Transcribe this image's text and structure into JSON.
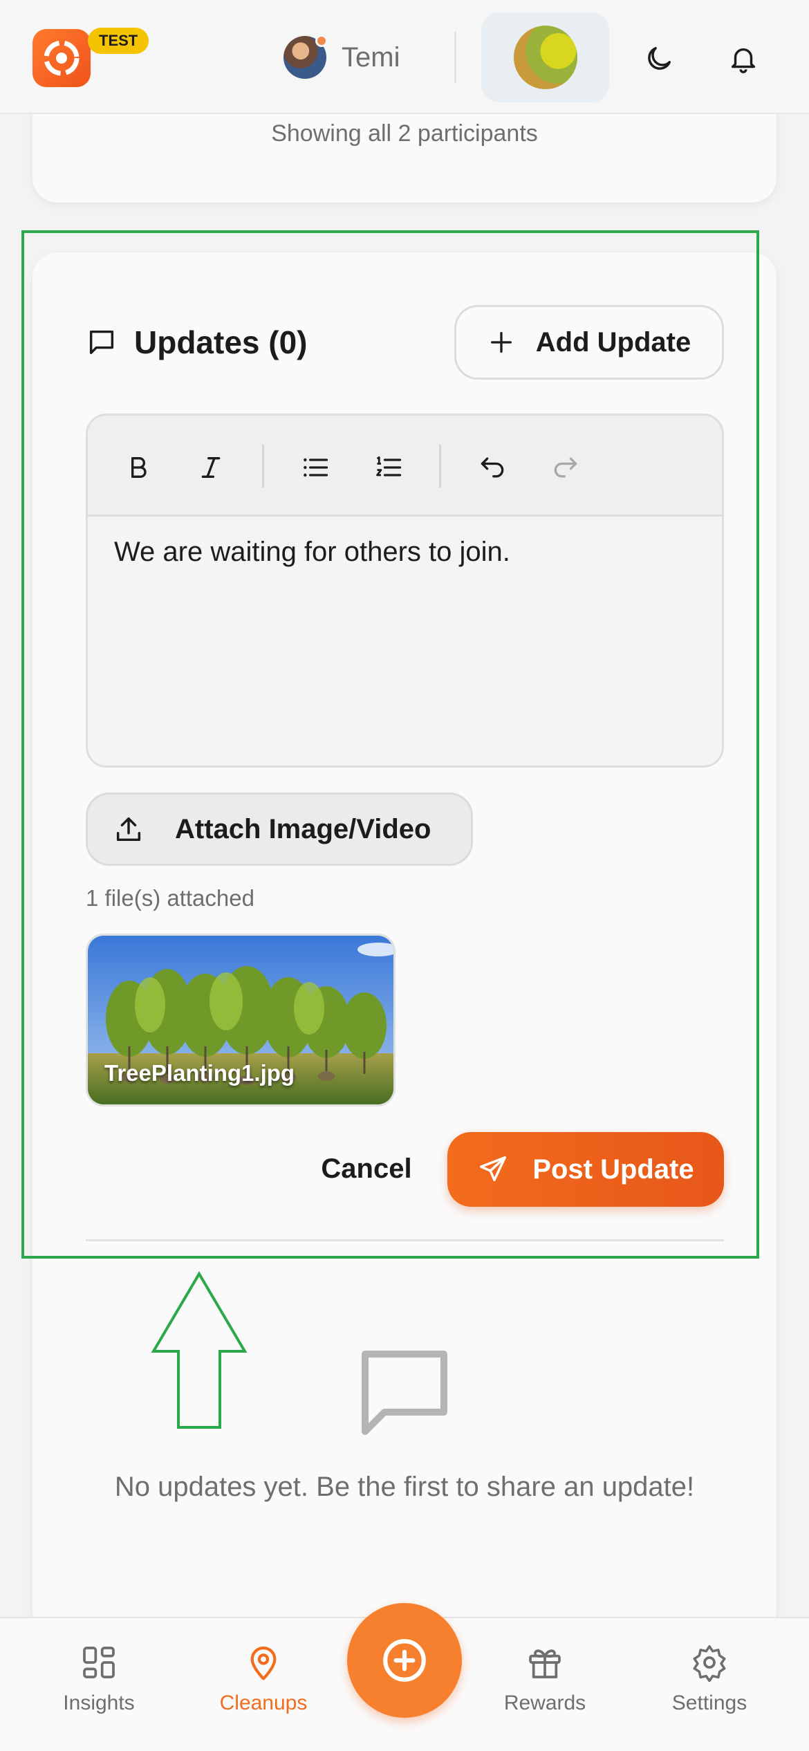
{
  "header": {
    "badge": "TEST",
    "user_name": "Temi"
  },
  "participants": {
    "summary": "Showing all 2 participants"
  },
  "updates": {
    "title": "Updates (0)",
    "add_button": "Add Update",
    "editor_text": "We are waiting for others to join.",
    "attach_button": "Attach Image/Video",
    "files_count": "1 file(s) attached",
    "attachment_name": "TreePlanting1.jpg",
    "cancel_button": "Cancel",
    "post_button": "Post Update",
    "empty_message": "No updates yet. Be the first to share an update!"
  },
  "nav": {
    "items": [
      {
        "label": "Insights",
        "icon": "grid-icon"
      },
      {
        "label": "Cleanups",
        "icon": "map-pin-icon",
        "active": true
      },
      {
        "label": "Rewards",
        "icon": "gift-icon"
      },
      {
        "label": "Settings",
        "icon": "gear-icon"
      }
    ]
  },
  "colors": {
    "accent": "#f26c1c",
    "highlight": "#2aa84a",
    "badge": "#f5c400"
  }
}
